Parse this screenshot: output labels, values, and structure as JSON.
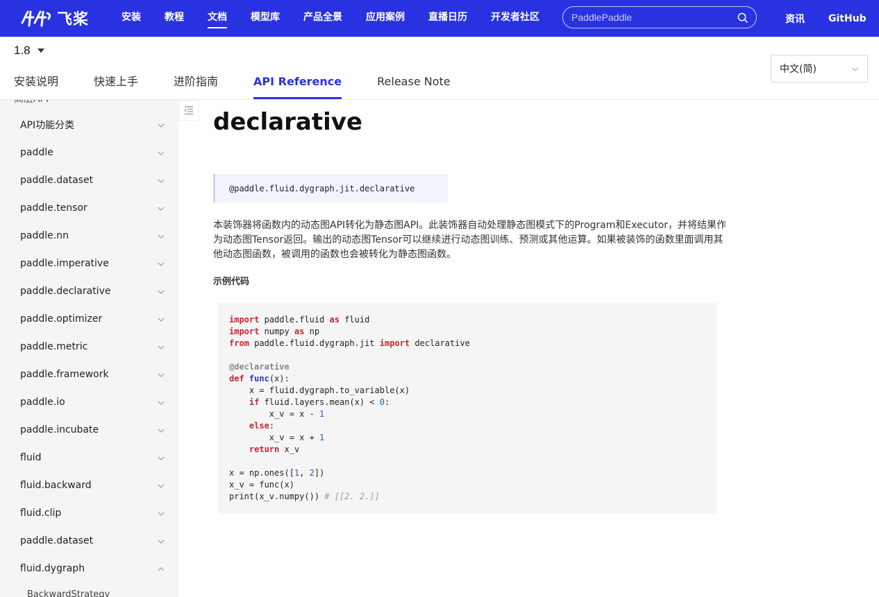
{
  "topbar": {
    "logo_text": "飞桨",
    "nav": [
      "安装",
      "教程",
      "文档",
      "模型库",
      "产品全景",
      "应用案例",
      "直播日历",
      "开发者社区"
    ],
    "active_nav": "文档",
    "search_placeholder": "PaddlePaddle",
    "right_links": [
      "资讯",
      "GitHub"
    ],
    "brand_color": "#2932e1"
  },
  "subheader": {
    "version": "1.8",
    "tabs": [
      "安装说明",
      "快速上手",
      "进阶指南",
      "API Reference",
      "Release Note"
    ],
    "active_tab": "API Reference",
    "language": "中文(简)"
  },
  "sidebar": {
    "cut_label": "高层API",
    "items": [
      {
        "label": "API功能分类",
        "expanded": false
      },
      {
        "label": "paddle",
        "expanded": false
      },
      {
        "label": "paddle.dataset",
        "expanded": false
      },
      {
        "label": "paddle.tensor",
        "expanded": false
      },
      {
        "label": "paddle.nn",
        "expanded": false
      },
      {
        "label": "paddle.imperative",
        "expanded": false
      },
      {
        "label": "paddle.declarative",
        "expanded": false
      },
      {
        "label": "paddle.optimizer",
        "expanded": false
      },
      {
        "label": "paddle.metric",
        "expanded": false
      },
      {
        "label": "paddle.framework",
        "expanded": false
      },
      {
        "label": "paddle.io",
        "expanded": false
      },
      {
        "label": "paddle.incubate",
        "expanded": false
      },
      {
        "label": "fluid",
        "expanded": false
      },
      {
        "label": "fluid.backward",
        "expanded": false
      },
      {
        "label": "fluid.clip",
        "expanded": false
      },
      {
        "label": "paddle.dataset",
        "expanded": false
      },
      {
        "label": "fluid.dygraph",
        "expanded": true
      }
    ],
    "sub_item": "BackwardStrategy"
  },
  "main": {
    "title": "declarative",
    "signature": "@paddle.fluid.dygraph.jit.declarative",
    "description": "本装饰器将函数内的动态图API转化为静态图API。此装饰器自动处理静态图模式下的Program和Executor，并将结果作为动态图Tensor返回。输出的动态图Tensor可以继续进行动态图训练、预测或其他运算。如果被装饰的函数里面调用其他动态图函数，被调用的函数也会被转化为静态图函数。",
    "example_title": "示例代码",
    "code_lines": [
      [
        [
          "kw",
          "import"
        ],
        [
          "t",
          " paddle.fluid "
        ],
        [
          "kw",
          "as"
        ],
        [
          "t",
          " fluid"
        ]
      ],
      [
        [
          "kw",
          "import"
        ],
        [
          "t",
          " numpy "
        ],
        [
          "kw",
          "as"
        ],
        [
          "t",
          " np"
        ]
      ],
      [
        [
          "kw",
          "from"
        ],
        [
          "t",
          " paddle.fluid.dygraph.jit "
        ],
        [
          "kw",
          "import"
        ],
        [
          "t",
          " declarative"
        ]
      ],
      [],
      [
        [
          "dec",
          "@declarative"
        ]
      ],
      [
        [
          "kw",
          "def"
        ],
        [
          "t",
          " "
        ],
        [
          "fn",
          "func"
        ],
        [
          "t",
          "(x):"
        ]
      ],
      [
        [
          "t",
          "    x = fluid.dygraph.to_variable(x)"
        ]
      ],
      [
        [
          "t",
          "    "
        ],
        [
          "kw",
          "if"
        ],
        [
          "t",
          " fluid.layers.mean(x) < "
        ],
        [
          "num",
          "0"
        ],
        [
          "t",
          ":"
        ]
      ],
      [
        [
          "t",
          "        x_v = x - "
        ],
        [
          "num",
          "1"
        ]
      ],
      [
        [
          "t",
          "    "
        ],
        [
          "kw",
          "else"
        ],
        [
          "t",
          ":"
        ]
      ],
      [
        [
          "t",
          "        x_v = x + "
        ],
        [
          "num",
          "1"
        ]
      ],
      [
        [
          "t",
          "    "
        ],
        [
          "kw",
          "return"
        ],
        [
          "t",
          " x_v"
        ]
      ],
      [],
      [
        [
          "t",
          "x = np.ones(["
        ],
        [
          "num",
          "1"
        ],
        [
          "t",
          ", "
        ],
        [
          "num",
          "2"
        ],
        [
          "t",
          "])"
        ]
      ],
      [
        [
          "t",
          "x_v = func(x)"
        ]
      ],
      [
        [
          "t",
          "print(x_v.numpy()) "
        ],
        [
          "cm",
          "# [[2. 2.]]"
        ]
      ]
    ]
  }
}
